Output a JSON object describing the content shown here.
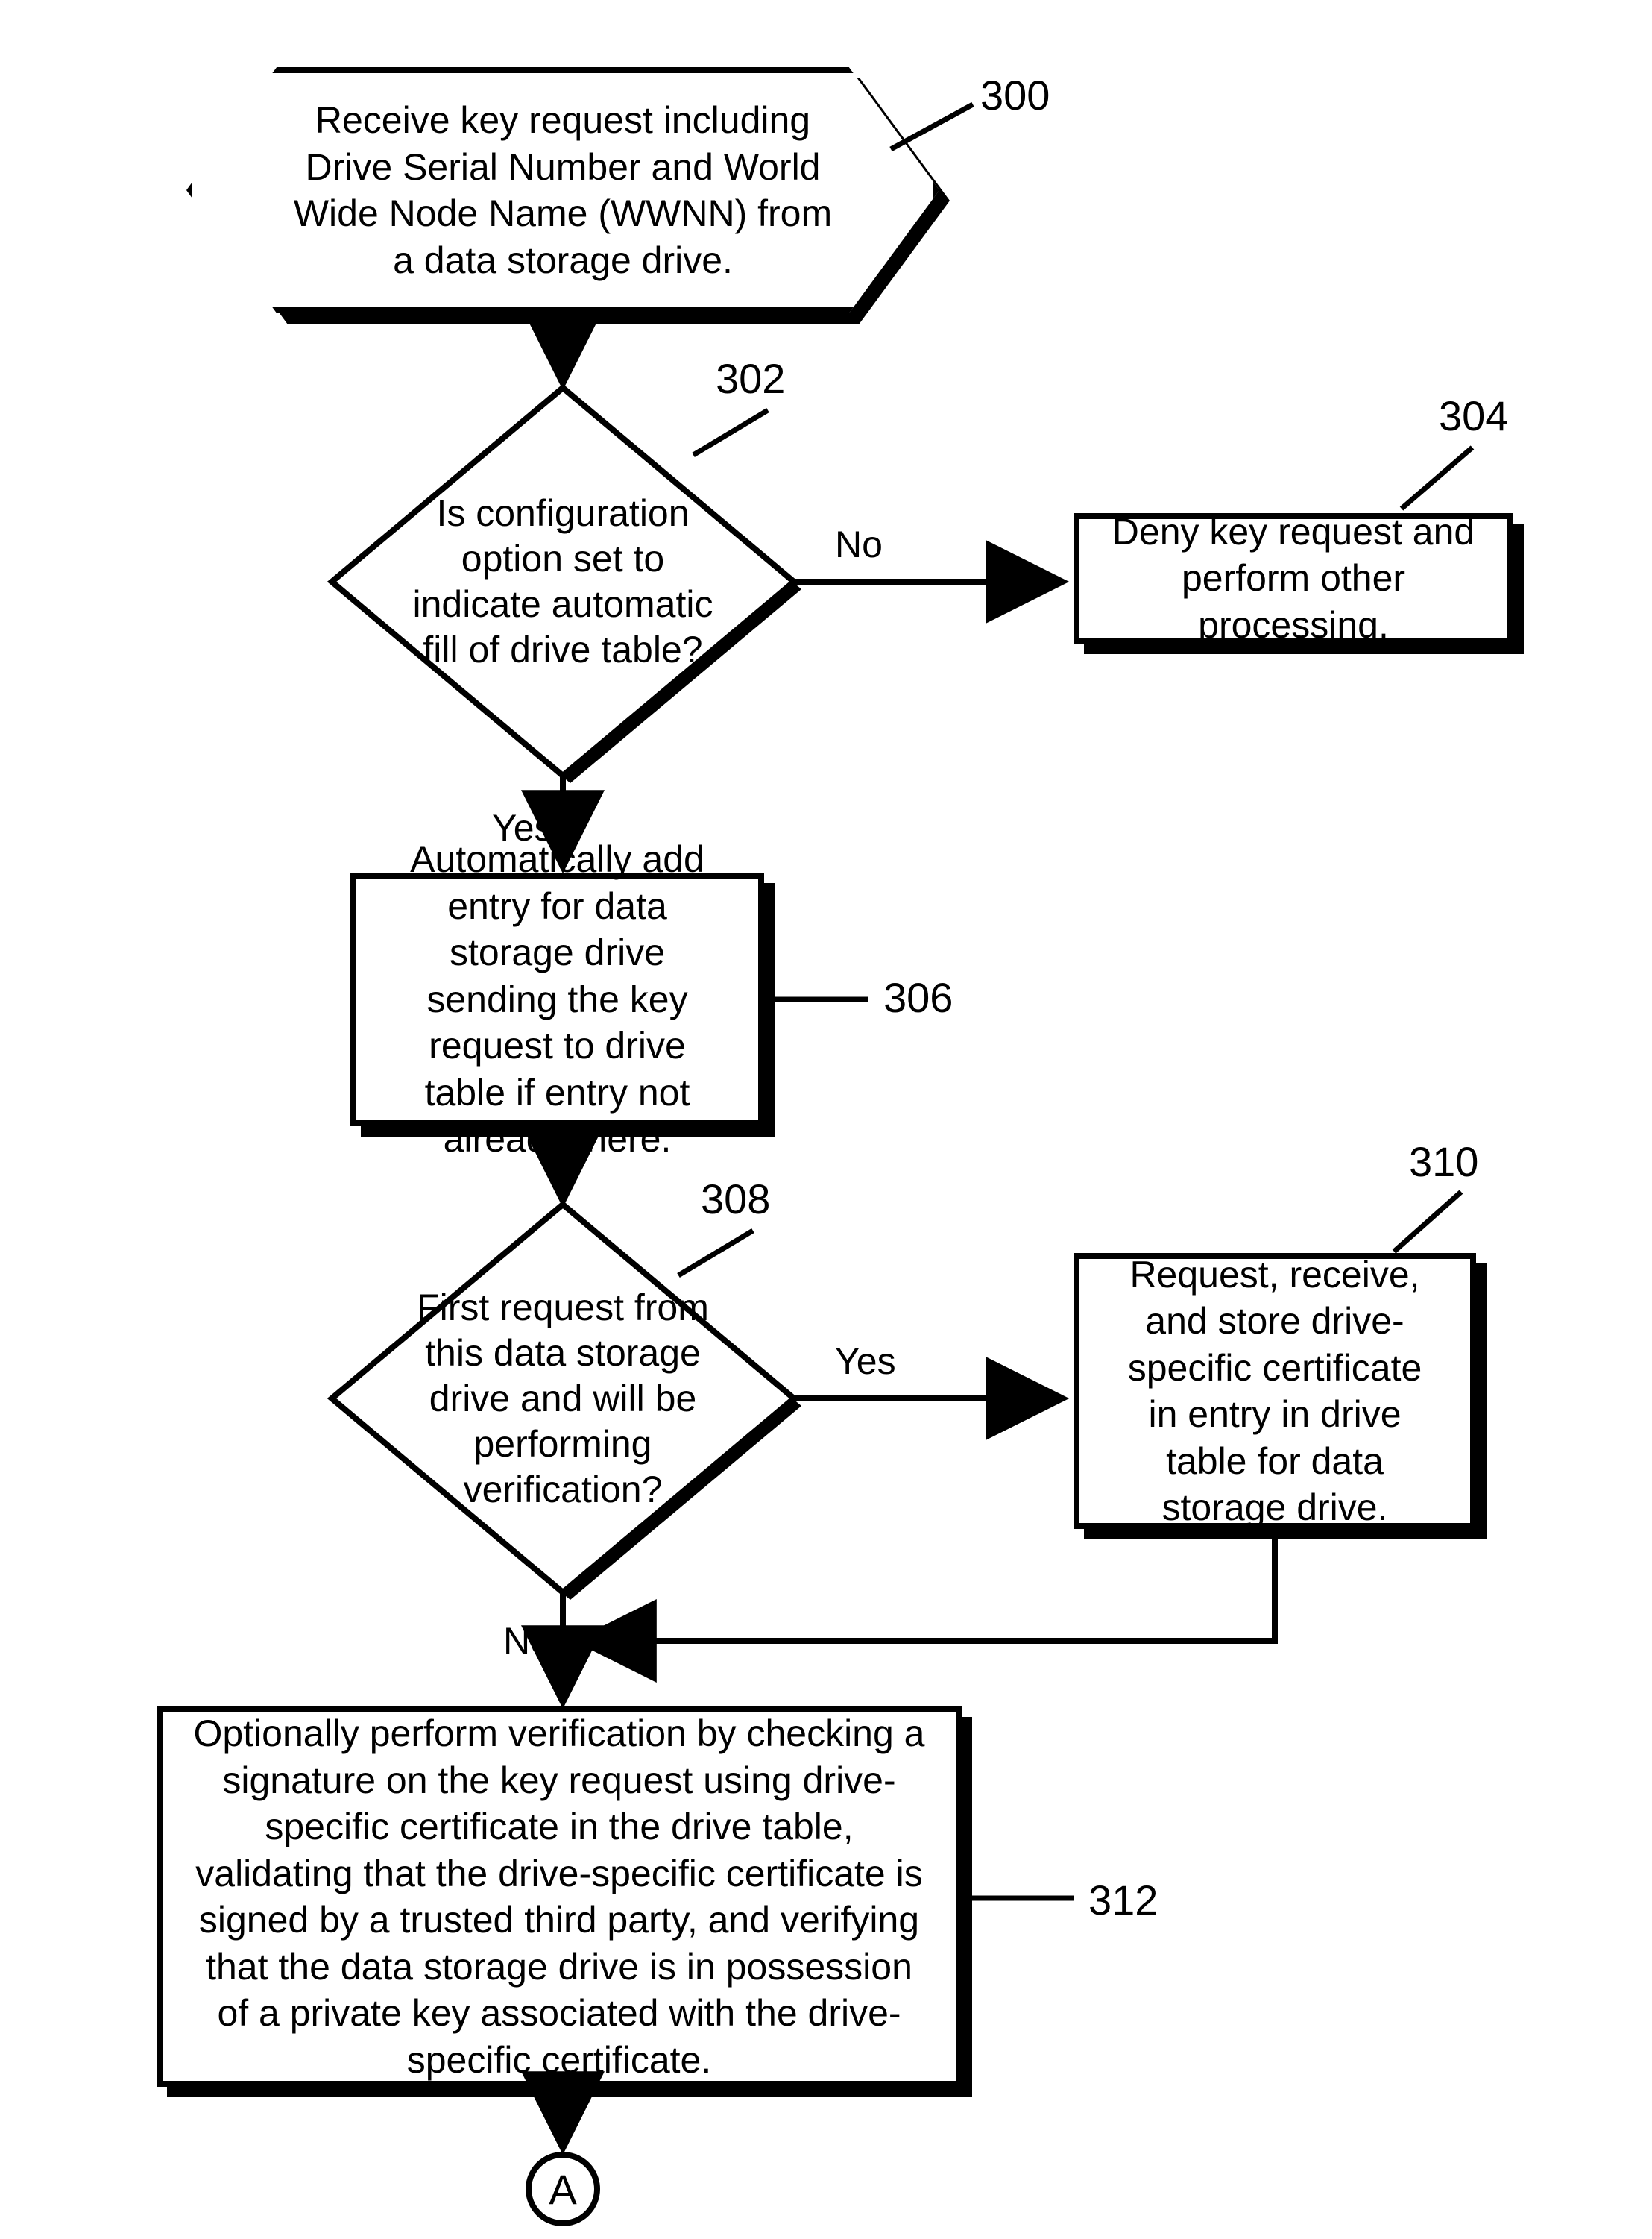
{
  "chart_data": {
    "type": "flowchart",
    "nodes": [
      {
        "id": "300",
        "shape": "hexagon",
        "text": "Receive key request including Drive Serial Number and World Wide Node Name (WWNN) from a data storage drive."
      },
      {
        "id": "302",
        "shape": "diamond",
        "text": "Is configuration option set to indicate automatic fill of drive table?"
      },
      {
        "id": "304",
        "shape": "rect",
        "text": "Deny key request and perform other processing."
      },
      {
        "id": "306",
        "shape": "rect",
        "text": "Automatically add entry for data storage drive sending the key request to drive table if entry not already there."
      },
      {
        "id": "308",
        "shape": "diamond",
        "text": "First request from this data storage drive and will be performing verification?"
      },
      {
        "id": "310",
        "shape": "rect",
        "text": "Request, receive, and store drive-specific certificate in entry in drive table for data storage drive."
      },
      {
        "id": "312",
        "shape": "rect",
        "text": "Optionally perform verification by checking a signature on the key request using drive-specific certificate in the drive table, validating that the drive-specific certificate is signed by a trusted third party, and verifying that the data storage drive is in possession of a private key associated with the drive-specific certificate."
      },
      {
        "id": "A",
        "shape": "circle",
        "text": "A"
      }
    ],
    "edges": [
      {
        "from": "300",
        "to": "302",
        "label": ""
      },
      {
        "from": "302",
        "to": "304",
        "label": "No"
      },
      {
        "from": "302",
        "to": "306",
        "label": "Yes"
      },
      {
        "from": "306",
        "to": "308",
        "label": ""
      },
      {
        "from": "308",
        "to": "310",
        "label": "Yes"
      },
      {
        "from": "308",
        "to": "312",
        "label": "No"
      },
      {
        "from": "310",
        "to": "312",
        "label": ""
      },
      {
        "from": "312",
        "to": "A",
        "label": ""
      }
    ]
  },
  "nodes": {
    "n300": {
      "ref": "300",
      "text": "Receive key request including Drive Serial Number and World Wide Node Name (WWNN) from a data storage drive."
    },
    "n302": {
      "ref": "302",
      "text": "Is configuration option set to indicate automatic fill of drive table?"
    },
    "n304": {
      "ref": "304",
      "text": "Deny key request and perform other processing."
    },
    "n306": {
      "ref": "306",
      "text": "Automatically add entry for data storage drive sending the key request to drive table if entry not already there."
    },
    "n308": {
      "ref": "308",
      "text": "First request from this data storage drive and will be performing verification?"
    },
    "n310": {
      "ref": "310",
      "text": "Request, receive, and store drive-specific certificate in entry in drive table for data storage drive."
    },
    "n312": {
      "ref": "312",
      "text": "Optionally perform verification by checking a signature on the key request using drive-specific certificate in the drive table, validating that the drive-specific certificate is signed by a trusted third party, and verifying that the data storage drive is in possession of a private key associated with the drive-specific certificate."
    },
    "nA": {
      "ref": "A",
      "text": "A"
    }
  },
  "edge_labels": {
    "e302_304": "No",
    "e302_306": "Yes",
    "e308_310": "Yes",
    "e308_312": "No"
  }
}
